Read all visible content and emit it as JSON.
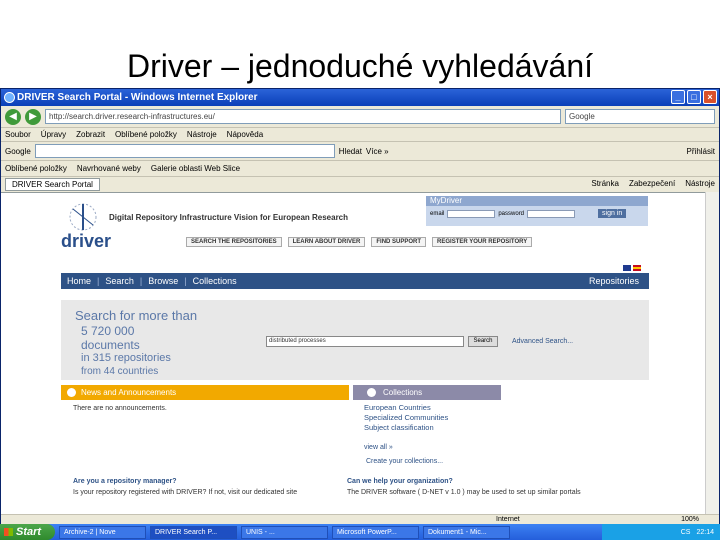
{
  "slide": {
    "title": "Driver – jednoduché vyhledávání"
  },
  "window": {
    "title": "DRIVER Search Portal - Windows Internet Explorer",
    "address": "http://search.driver.research-infrastructures.eu/",
    "search_placeholder": "Google",
    "menu": [
      "Soubor",
      "Úpravy",
      "Zobrazit",
      "Oblíbené položky",
      "Nástroje",
      "Nápověda"
    ],
    "google_label": "Google",
    "google_search_btn": "Hledat",
    "google_more": "Více »",
    "google_signin": "Přihlásit",
    "favorites": [
      "Oblíbené položky",
      "Navrhované weby",
      "Galerie oblasti Web Slice"
    ],
    "tab_label": "DRIVER Search Portal",
    "tab_tools": [
      "Stránka",
      "Zabezpečení",
      "Nástroje"
    ]
  },
  "page": {
    "logo_text": "driver",
    "tagline": "Digital Repository Infrastructure Vision for European Research",
    "top_nav": [
      "SEARCH THE REPOSITORIES",
      "LEARN ABOUT DRIVER",
      "FIND SUPPORT",
      "REGISTER YOUR REPOSITORY"
    ],
    "mydriver": {
      "title": "MyDriver",
      "email_label": "email",
      "password_label": "password",
      "signin": "sign in"
    },
    "main_nav": [
      "Home",
      "Search",
      "Browse",
      "Collections"
    ],
    "repositories_link": "Repositories",
    "search": {
      "title": "Search for more than",
      "count": "5 720 000",
      "documents": "documents",
      "repos": "in 315 repositories",
      "countries": "from 44 countries",
      "input_value": "distributed processes",
      "button": "Search",
      "advanced": "Advanced Search..."
    },
    "news": {
      "title": "News and Announcements",
      "text": "There are no announcements."
    },
    "collections": {
      "title": "Collections",
      "items": [
        "European Countries",
        "Specialized Communities",
        "Subject classification"
      ],
      "view_all": "view all »",
      "create_own": "Create your collections..."
    },
    "manager": {
      "question": "Are you a repository manager?",
      "text": "Is your repository registered with DRIVER? If not, visit our dedicated site"
    },
    "organization": {
      "question": "Can we help your organization?",
      "text": "The DRIVER software ( D-NET v 1.0 ) may be used to set up similar portals"
    }
  },
  "statusbar": {
    "zone": "Internet",
    "zoom": "100%"
  },
  "taskbar": {
    "start": "Start",
    "buttons": [
      "Archive-2 | Nove",
      "DRIVER Search P...",
      "UNIS - ...",
      "Microsoft PowerP...",
      "Dokument1 - Mic..."
    ],
    "tray": [
      "CS",
      "22:14"
    ]
  },
  "colors": {
    "nav_blue": "#2e5286",
    "news_orange": "#f2a900",
    "collections_purple": "#8c8aa8"
  }
}
